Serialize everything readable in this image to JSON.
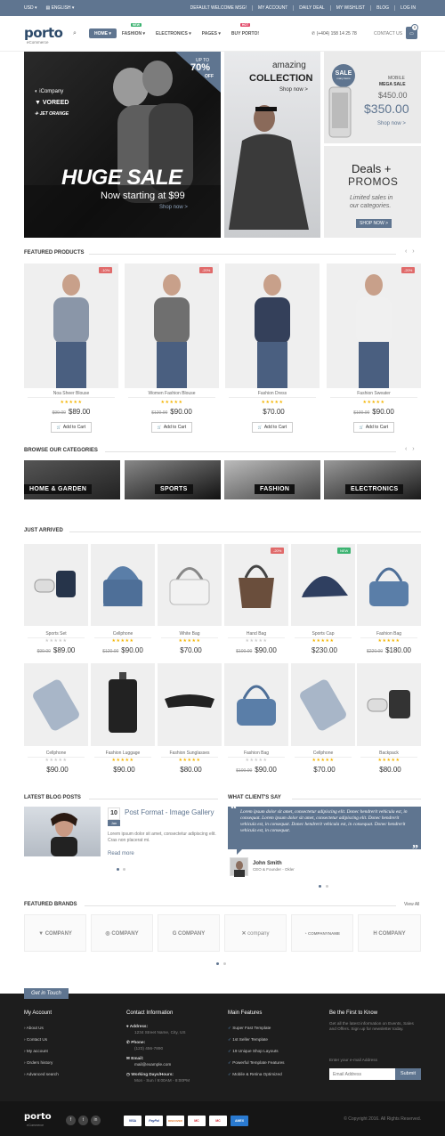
{
  "topbar": {
    "currency": "USD",
    "language": "ENGLISH",
    "links": [
      "DEFAULT WELCOME MSG!",
      "MY ACCOUNT",
      "DAILY DEAL",
      "MY WISHLIST",
      "BLOG",
      "LOG IN"
    ]
  },
  "header": {
    "logo": "porto",
    "logo_sub": "eCommerce",
    "nav": [
      {
        "label": "HOME",
        "active": true
      },
      {
        "label": "FASHION",
        "tag": "NEW",
        "tag_color": "#3cb371"
      },
      {
        "label": "ELECTRONICS"
      },
      {
        "label": "PAGES"
      },
      {
        "label": "BUY PORTO!",
        "tag": "HOT",
        "tag_color": "#e24a6a"
      }
    ],
    "phone": "(+404) 158 14 25 78",
    "contact": "CONTACT US",
    "cart_count": "0"
  },
  "banners": {
    "b1": {
      "brands": [
        "iCompany",
        "VOREED",
        "JET ORANGE"
      ],
      "upto": "UP TO",
      "percent": "70%",
      "off": "OFF",
      "headline": "HUGE SALE",
      "sub": "Now starting at $99",
      "cta": "Shop now >"
    },
    "b2": {
      "top": "amazing",
      "title": "COLLECTION",
      "cta": "Shop now >"
    },
    "b3": {
      "badge": "SALE",
      "badge_sub": "many items",
      "label": "MOBILE",
      "label2": "MEGA SALE",
      "old": "$450.00",
      "new": "$350.00",
      "cta": "Shop now >"
    },
    "b4": {
      "title": "Deals",
      "plus": "+",
      "title2": "PROMOS",
      "sub": "Limited sales in",
      "sub2": "our categories.",
      "cta": "SHOP NOW >"
    }
  },
  "featured": {
    "title": "FEATURED PRODUCTS",
    "items": [
      {
        "name": "Noa Sheer Blouse",
        "old": "$99.00",
        "price": "$89.00",
        "badge": "-10%",
        "stars": "★★★★★",
        "btn": "Add to Cart"
      },
      {
        "name": "Women Fashion Blouse",
        "old": "$120.00",
        "price": "$90.00",
        "badge": "-20%",
        "stars": "★★★★★",
        "btn": "Add to Cart"
      },
      {
        "name": "Fashion Dress",
        "old": "",
        "price": "$70.00",
        "badge": "",
        "stars": "★★★★★",
        "btn": "Add to Cart"
      },
      {
        "name": "Fashion Sweater",
        "old": "$100.00",
        "price": "$90.00",
        "badge": "-20%",
        "stars": "★★★★★",
        "btn": "Add to Cart"
      }
    ]
  },
  "categories": {
    "title": "BROWSE OUR CATEGORIES",
    "items": [
      "HOME & GARDEN",
      "SPORTS",
      "FASHION",
      "ELECTRONICS"
    ]
  },
  "arrived": {
    "title": "JUST ARRIVED",
    "row1": [
      {
        "name": "Sports Set",
        "old": "$99.00",
        "price": "$89.00",
        "badge": ""
      },
      {
        "name": "Cellphone",
        "old": "$120.00",
        "price": "$90.00",
        "badge": ""
      },
      {
        "name": "White Bag",
        "old": "",
        "price": "$70.00",
        "badge": ""
      },
      {
        "name": "Hand Bag",
        "old": "$100.00",
        "price": "$90.00",
        "badge": "-20%"
      },
      {
        "name": "Sports Cap",
        "old": "",
        "price": "$230.00",
        "badge": "NEW"
      },
      {
        "name": "Fashion Bag",
        "old": "$220.00",
        "price": "$180.00",
        "badge": ""
      }
    ],
    "row2": [
      {
        "name": "Cellphone",
        "old": "",
        "price": "$90.00"
      },
      {
        "name": "Fashion Luggage",
        "old": "",
        "price": "$90.00"
      },
      {
        "name": "Fashion Sunglasses",
        "old": "",
        "price": "$80.00"
      },
      {
        "name": "Fashion Bag",
        "old": "$100.00",
        "price": "$90.00"
      },
      {
        "name": "Cellphone",
        "old": "",
        "price": "$70.00"
      },
      {
        "name": "Backpack",
        "old": "",
        "price": "$80.00"
      }
    ]
  },
  "blog": {
    "title": "LATEST BLOG POSTS",
    "day": "10",
    "month": "Jan",
    "post_title": "Post Format - Image Gallery",
    "excerpt": "Lorem ipsum dolor sit amet, consectetur adipiscing elit. Cras non placerat mi.",
    "read_more": "Read more"
  },
  "testimonial": {
    "title": "WHAT CLIENT'S SAY",
    "text": "Lorem ipsum dolor sit amet, consectetur adipiscing elit. Donec hendrerit vehicula est, in consequat. Lorem ipsum dolor sit amet, consectetur adipiscing elit. Donec hendrerit vehicula est, in consequat. Donec hendrerit vehicula est, in consequat. Donec hendrerit vehicula est, in consequat.",
    "name": "John Smith",
    "role": "CEO & Founder - Okler"
  },
  "brands": {
    "title": "FEATURED BRANDS",
    "view_all": "View All",
    "items": [
      "COMPANY",
      "COMPANY",
      "COMPANY",
      "company",
      "COMPANYNAME",
      "COMPANY"
    ]
  },
  "footer": {
    "tab": "Get in Touch",
    "account": {
      "title": "My Account",
      "links": [
        "About Us",
        "Contact Us",
        "My account",
        "Orders history",
        "Advanced search"
      ]
    },
    "contact": {
      "title": "Contact Information",
      "address_label": "Address:",
      "address": "1234 Street Name, City, US",
      "phone_label": "Phone:",
      "phone": "(123) 456-7890",
      "email_label": "Email:",
      "email": "mail@example.com",
      "hours_label": "Working Days/Hours:",
      "hours": "Mon - Sun / 9:00AM - 8:00PM"
    },
    "features": {
      "title": "Main Features",
      "items": [
        "Super Fast Template",
        "1st Seller Template",
        "19 Unique Shop Layouts",
        "Powerful Template Features",
        "Mobile & Retina Optimized"
      ]
    },
    "newsletter": {
      "title": "Be the First to Know",
      "text": "Get all the latest information on Events, Sales and Offers. Sign up for newsletter today.",
      "label": "Enter your e-mail Address",
      "placeholder": "Email Address",
      "btn": "Submit"
    }
  },
  "bottom": {
    "logo": "porto",
    "logo_sub": "eCommerce",
    "payments": [
      "VISA",
      "PayPal",
      "DISCOVER",
      "MC",
      "MC",
      "AMEX"
    ],
    "copyright": "© Copyright 2016. All Rights Reserved."
  }
}
